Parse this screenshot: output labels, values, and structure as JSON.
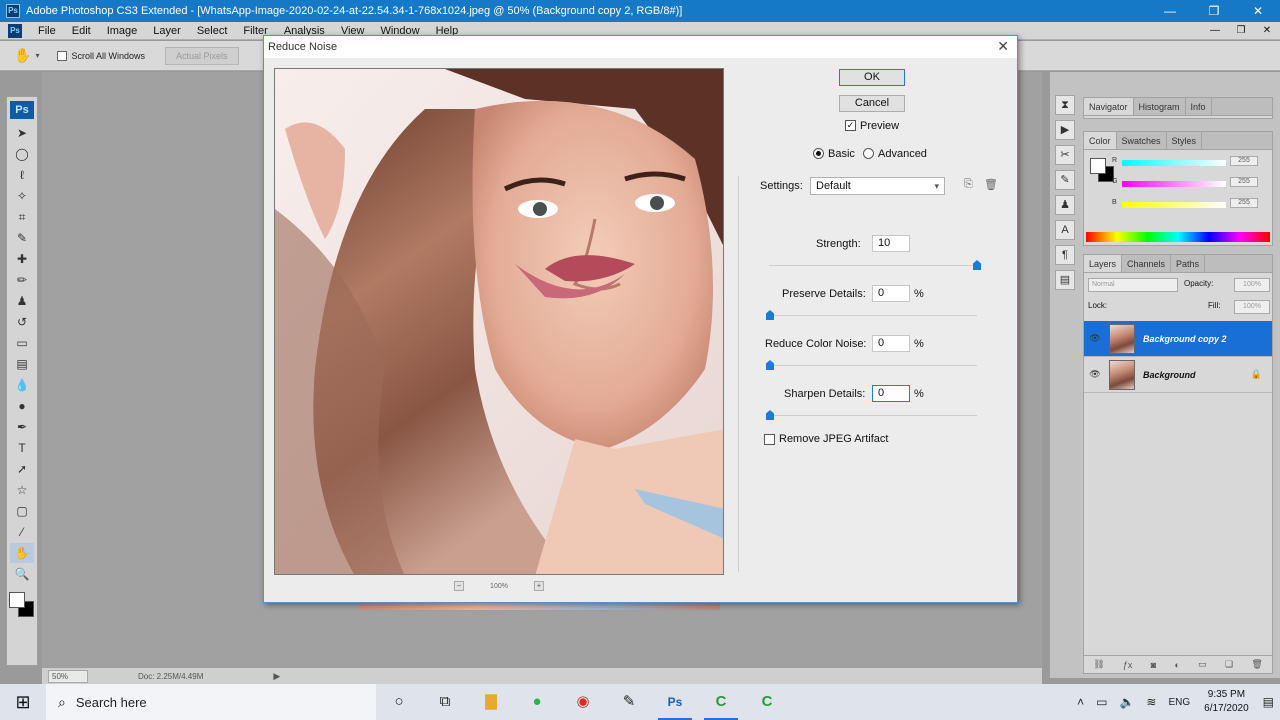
{
  "app": {
    "window_title": "Adobe Photoshop CS3 Extended - [WhatsApp-Image-2020-02-24-at-22.54.34-1-768x1024.jpeg @ 50% (Background copy 2, RGB/8#)]",
    "ps_logo": "Ps",
    "window_controls": [
      "—",
      "❐",
      "✕"
    ],
    "doc_controls": [
      "—",
      "❐",
      "✕"
    ]
  },
  "menu": [
    "File",
    "Edit",
    "Image",
    "Layer",
    "Select",
    "Filter",
    "Analysis",
    "View",
    "Window",
    "Help"
  ],
  "options_bar": {
    "scroll_all_label": "Scroll All Windows",
    "actual_pixels_label": "Actual Pixels"
  },
  "status_bar": {
    "zoom": "50%",
    "doc_size": "Doc: 2.25M/4.49M"
  },
  "dialog": {
    "title": "Reduce Noise",
    "ok_label": "OK",
    "cancel_label": "Cancel",
    "preview_label": "Preview",
    "preview_checked": true,
    "mode_basic": "Basic",
    "mode_advanced": "Advanced",
    "mode_selected": "Basic",
    "settings_label": "Settings:",
    "settings_value": "Default",
    "zoom_level": "100%",
    "zoom_minus": "−",
    "zoom_plus": "+",
    "strength_label": "Strength:",
    "strength_value": "10",
    "strength_max": 10,
    "preserve_label": "Preserve Details:",
    "preserve_value": "0",
    "color_noise_label": "Reduce Color Noise:",
    "color_noise_value": "0",
    "sharpen_label": "Sharpen Details:",
    "sharpen_value": "0",
    "percent": "%",
    "jpeg_label": "Remove JPEG Artifact",
    "jpeg_checked": false
  },
  "panels": {
    "nav_tabs": [
      "Navigator",
      "Histogram",
      "Info"
    ],
    "color_tabs": [
      "Color",
      "Swatches",
      "Styles"
    ],
    "color_channels": [
      {
        "label": "R",
        "value": "255"
      },
      {
        "label": "G",
        "value": "255"
      },
      {
        "label": "B",
        "value": "255"
      }
    ],
    "layers_tabs": [
      "Layers",
      "Channels",
      "Paths"
    ],
    "blend_mode": "Normal",
    "opacity_label": "Opacity:",
    "opacity_value": "100%",
    "lock_label": "Lock:",
    "fill_label": "Fill:",
    "fill_value": "100%",
    "layers": [
      {
        "name": "Background copy 2",
        "selected": true,
        "locked": false
      },
      {
        "name": "Background",
        "selected": false,
        "locked": true
      }
    ]
  },
  "taskbar": {
    "search_placeholder": "Search here",
    "language": "ENG",
    "time": "9:35 PM",
    "date": "6/17/2020"
  },
  "colors": {
    "titlebar": "#1679c8",
    "selection": "#1a6fd6",
    "slider_thumb": "#1d7bd8"
  }
}
